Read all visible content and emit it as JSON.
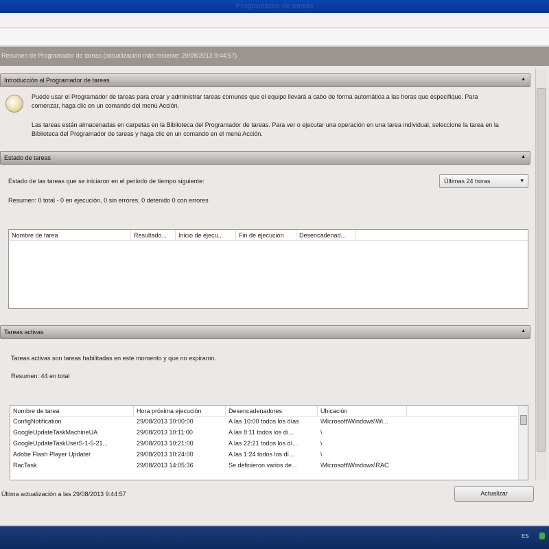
{
  "window": {
    "title": "Programador de tareas"
  },
  "summary_bar": "Resumen de Programador de tareas (actualización más reciente: 29/08/2013 9:44:57)",
  "intro": {
    "header": "Introducción al Programador de tareas",
    "p1": "Puede usar el Programador de tareas para crear y administrar tareas comunes que el equipo llevará a cabo de forma automática a las horas que especifique. Para comenzar, haga clic en un comando del menú Acción.",
    "p2": "Las tareas están almacenadas en carpetas en la Biblioteca del Programador de tareas. Para ver o ejecutar una operación en una tarea individual, seleccione la tarea en la Biblioteca del Programador de tareas y haga clic en un comando en el menú Acción."
  },
  "status": {
    "header": "Estado de tareas",
    "label": "Estado de las tareas que se iniciaron en el período de tiempo siguiente:",
    "period": "Últimas 24 horas",
    "summary": "Resumen: 0 total - 0 en ejecución, 0 sin errores, 0 detenido 0 con errores",
    "columns": [
      "Nombre de tarea",
      "Resultado...",
      "Inicio de ejecu...",
      "Fin de ejecución",
      "Desencadenad..."
    ]
  },
  "active": {
    "header": "Tareas activas",
    "desc": "Tareas activas son tareas habilitadas en este momento y que no expiraron.",
    "summary": "Resumen: 44 en total",
    "columns": [
      "Nombre de tarea",
      "Hora próxima ejecución",
      "Desencadenadores",
      "Ubicación"
    ],
    "rows": [
      [
        "ConfigNotification",
        "29/08/2013 10:00:00",
        "A las 10:00 todos los días",
        "\\Microsoft\\Windows\\Wi..."
      ],
      [
        "GoogleUpdateTaskMachineUA",
        "29/08/2013 10:11:00",
        "A las 8:11 todos los dí...",
        "\\"
      ],
      [
        "GoogleUpdateTaskUserS-1-5-21...",
        "29/08/2013 10:21:00",
        "A las 22:21 todos los dí...",
        "\\"
      ],
      [
        "Adobe Flash Player Updater",
        "29/08/2013 10:24:00",
        "A las 1:24 todos los dí...",
        "\\"
      ],
      [
        "RacTask",
        "29/08/2013 14:05:36",
        "Se definieron varios de...",
        "\\Microsoft\\Windows\\RAC"
      ]
    ]
  },
  "footer": {
    "last_update": "Última actualización a las 29/08/2013 9:44:57",
    "refresh": "Actualizar"
  },
  "taskbar": {
    "lang": "ES"
  }
}
